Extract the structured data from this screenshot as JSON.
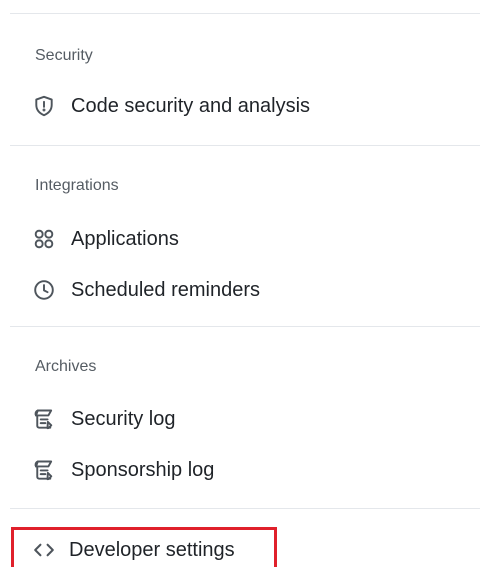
{
  "sections": [
    {
      "heading": "Security",
      "items": [
        {
          "label": "Code security and analysis",
          "icon": "shield-icon"
        }
      ]
    },
    {
      "heading": "Integrations",
      "items": [
        {
          "label": "Applications",
          "icon": "apps-grid-icon"
        },
        {
          "label": "Scheduled reminders",
          "icon": "clock-icon"
        }
      ]
    },
    {
      "heading": "Archives",
      "items": [
        {
          "label": "Security log",
          "icon": "log-icon"
        },
        {
          "label": "Sponsorship log",
          "icon": "log-icon"
        }
      ]
    }
  ],
  "developer": {
    "label": "Developer settings",
    "icon": "code-icon",
    "highlight_color": "#e0202b"
  },
  "colors": {
    "text": "#1f2328",
    "heading": "#555c63",
    "icon": "#4e555c",
    "divider": "#e4e7eb"
  }
}
